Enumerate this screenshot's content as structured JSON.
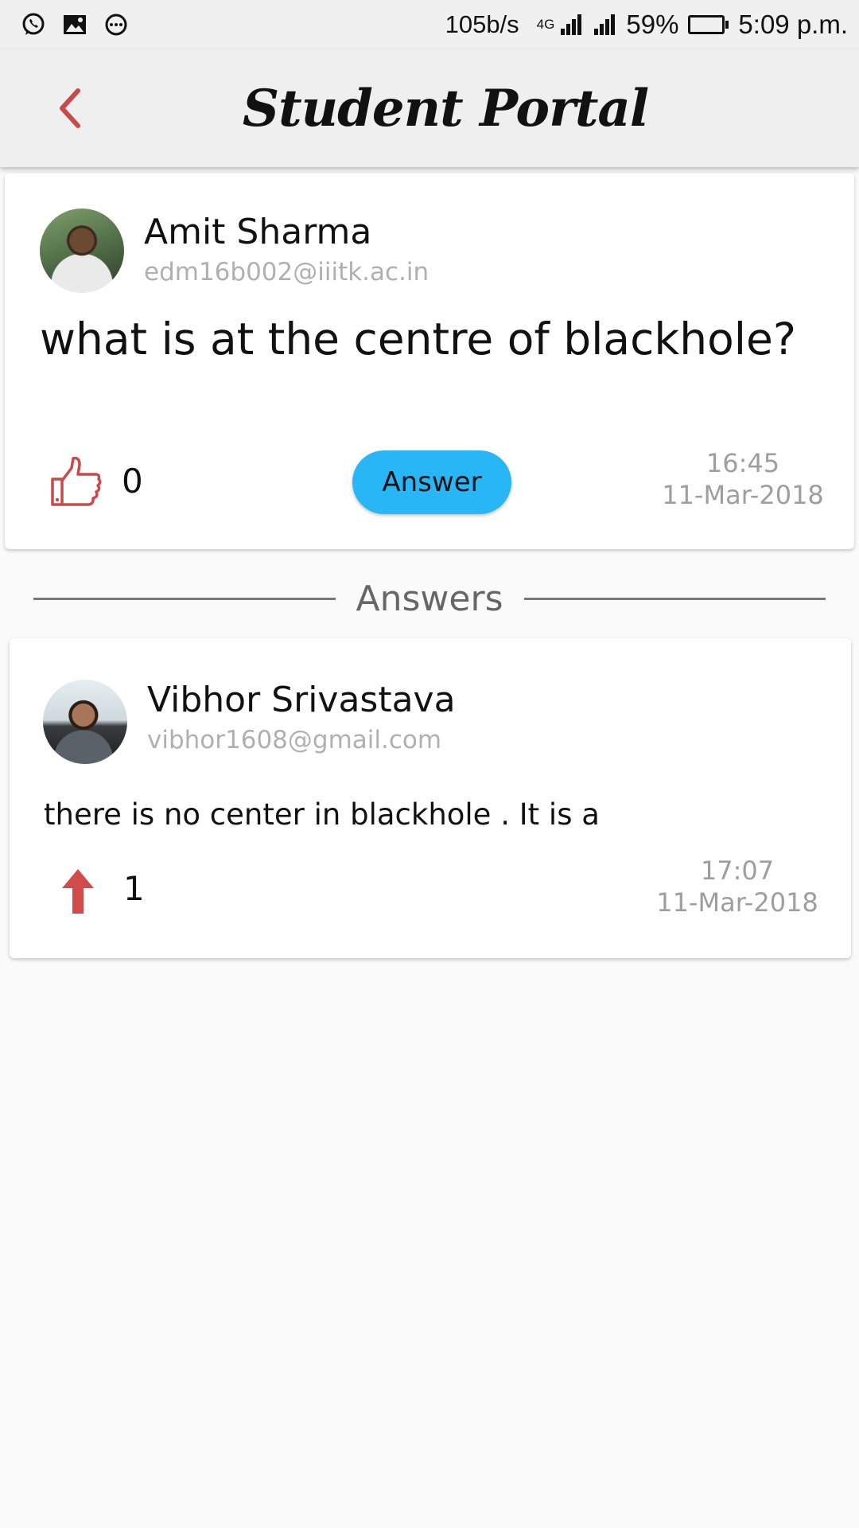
{
  "status_bar": {
    "net_speed": "105b/s",
    "network_type": "4G",
    "battery": "59%",
    "battery_level": 0.59,
    "time": "5:09 p.m.",
    "icons": [
      "whatsapp-icon",
      "gallery-icon",
      "more-icon",
      "signal-icon",
      "signal-icon-2",
      "battery-icon"
    ]
  },
  "app_bar": {
    "title": "Student Portal",
    "back_icon": "chevron-left-icon",
    "accent": "#c94a4a"
  },
  "question": {
    "author_name": "Amit Sharma",
    "author_email": "edm16b002@iiitk.ac.in",
    "text": "what is at the centre of blackhole?",
    "likes": "0",
    "answer_label": "Answer",
    "time": "16:45",
    "date": "11-Mar-2018",
    "answer_button_color": "#29b6f6"
  },
  "answers_section": {
    "label": "Answers"
  },
  "answers": [
    {
      "author_name": "Vibhor Srivastava",
      "author_email": "vibhor1608@gmail.com",
      "text": "there is no center in blackhole . It is a",
      "votes": "1",
      "time": "17:07",
      "date": "11-Mar-2018"
    }
  ]
}
